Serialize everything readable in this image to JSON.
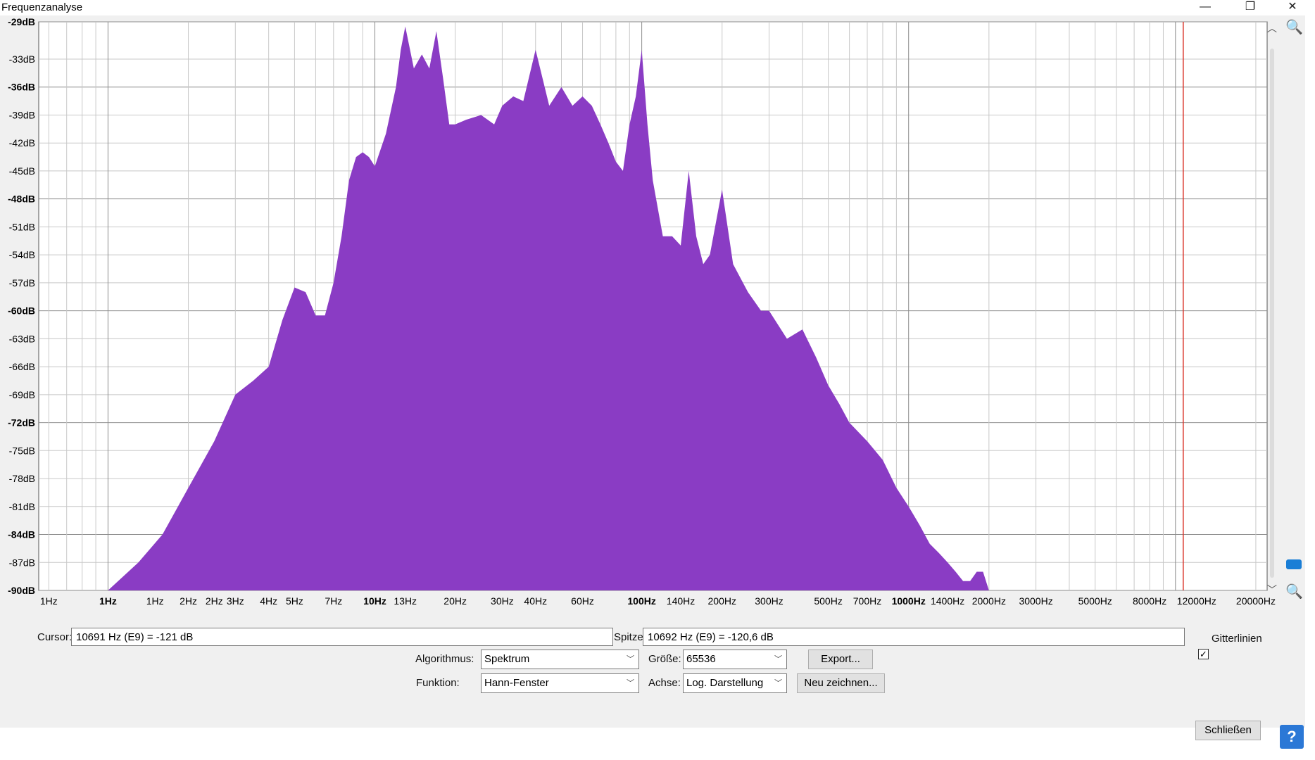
{
  "window": {
    "title": "Frequenzanalyse",
    "minimize": "—",
    "restore": "❐",
    "close": "✕"
  },
  "colors": {
    "spectrum": "#8a3cc4",
    "cursor_line": "#d9342b",
    "grid": "#c8c8c8",
    "grid_major": "#8c8c8c"
  },
  "chart_data": {
    "type": "area",
    "title": "",
    "xlabel": "",
    "ylabel": "",
    "x_scale": "log",
    "xlim": [
      1,
      22050
    ],
    "ylim": [
      -90,
      -29
    ],
    "grid": true,
    "legend": "none",
    "y_ticks": [
      {
        "label": "-29dB",
        "value": -29,
        "bold": true
      },
      {
        "label": "-33dB",
        "value": -33,
        "bold": false
      },
      {
        "label": "-36dB",
        "value": -36,
        "bold": true
      },
      {
        "label": "-39dB",
        "value": -39,
        "bold": false
      },
      {
        "label": "-42dB",
        "value": -42,
        "bold": false
      },
      {
        "label": "-45dB",
        "value": -45,
        "bold": false
      },
      {
        "label": "-48dB",
        "value": -48,
        "bold": true
      },
      {
        "label": "-51dB",
        "value": -51,
        "bold": false
      },
      {
        "label": "-54dB",
        "value": -54,
        "bold": false
      },
      {
        "label": "-57dB",
        "value": -57,
        "bold": false
      },
      {
        "label": "-60dB",
        "value": -60,
        "bold": true
      },
      {
        "label": "-63dB",
        "value": -63,
        "bold": false
      },
      {
        "label": "-66dB",
        "value": -66,
        "bold": false
      },
      {
        "label": "-69dB",
        "value": -69,
        "bold": false
      },
      {
        "label": "-72dB",
        "value": -72,
        "bold": true
      },
      {
        "label": "-75dB",
        "value": -75,
        "bold": false
      },
      {
        "label": "-78dB",
        "value": -78,
        "bold": false
      },
      {
        "label": "-81dB",
        "value": -81,
        "bold": false
      },
      {
        "label": "-84dB",
        "value": -84,
        "bold": true
      },
      {
        "label": "-87dB",
        "value": -87,
        "bold": false
      },
      {
        "label": "-90dB",
        "value": -90,
        "bold": true
      }
    ],
    "x_ticks": [
      {
        "label": "1Hz",
        "value": 0.6,
        "bold": false
      },
      {
        "label": "1Hz",
        "value": 1,
        "bold": true
      },
      {
        "label": "1Hz",
        "value": 1.5,
        "bold": false
      },
      {
        "label": "2Hz",
        "value": 2,
        "bold": false
      },
      {
        "label": "2Hz",
        "value": 2.5,
        "bold": false
      },
      {
        "label": "3Hz",
        "value": 3,
        "bold": false
      },
      {
        "label": "4Hz",
        "value": 4,
        "bold": false
      },
      {
        "label": "5Hz",
        "value": 5,
        "bold": false
      },
      {
        "label": "7Hz",
        "value": 7,
        "bold": false
      },
      {
        "label": "10Hz",
        "value": 10,
        "bold": true
      },
      {
        "label": "13Hz",
        "value": 13,
        "bold": false
      },
      {
        "label": "20Hz",
        "value": 20,
        "bold": false
      },
      {
        "label": "30Hz",
        "value": 30,
        "bold": false
      },
      {
        "label": "40Hz",
        "value": 40,
        "bold": false
      },
      {
        "label": "60Hz",
        "value": 60,
        "bold": false
      },
      {
        "label": "100Hz",
        "value": 100,
        "bold": true
      },
      {
        "label": "140Hz",
        "value": 140,
        "bold": false
      },
      {
        "label": "200Hz",
        "value": 200,
        "bold": false
      },
      {
        "label": "300Hz",
        "value": 300,
        "bold": false
      },
      {
        "label": "500Hz",
        "value": 500,
        "bold": false
      },
      {
        "label": "700Hz",
        "value": 700,
        "bold": false
      },
      {
        "label": "1000Hz",
        "value": 1000,
        "bold": true
      },
      {
        "label": "1400Hz",
        "value": 1400,
        "bold": false
      },
      {
        "label": "2000Hz",
        "value": 2000,
        "bold": false
      },
      {
        "label": "3000Hz",
        "value": 3000,
        "bold": false
      },
      {
        "label": "5000Hz",
        "value": 5000,
        "bold": false
      },
      {
        "label": "8000Hz",
        "value": 8000,
        "bold": false
      },
      {
        "label": "12000Hz",
        "value": 12000,
        "bold": false
      },
      {
        "label": "20000Hz",
        "value": 20000,
        "bold": false
      }
    ],
    "cursor_frequency": 10691,
    "series": [
      {
        "x": [
          1,
          1.3,
          1.6,
          2,
          2.5,
          3,
          3.5,
          4,
          4.5,
          5,
          5.5,
          6,
          6.5,
          7,
          7.5,
          8,
          8.5,
          9,
          9.5,
          10,
          11,
          12,
          12.5,
          13,
          14,
          15,
          16,
          17,
          18,
          19,
          20,
          22,
          25,
          28,
          30,
          33,
          36,
          40,
          45,
          50,
          55,
          60,
          65,
          70,
          75,
          80,
          85,
          90,
          95,
          100,
          105,
          110,
          120,
          130,
          140,
          150,
          160,
          170,
          180,
          200,
          220,
          250,
          280,
          300,
          350,
          400,
          450,
          500,
          550,
          600,
          700,
          800,
          900,
          1000,
          1100,
          1200,
          1300,
          1400,
          1500,
          1600,
          1700,
          1800,
          1900,
          2000,
          2100
        ],
        "y": [
          -90,
          -87,
          -84,
          -79,
          -74,
          -69,
          -67.5,
          -66,
          -61,
          -57.5,
          -58,
          -60.5,
          -60.5,
          -57,
          -52,
          -46,
          -43.5,
          -43,
          -43.5,
          -44.5,
          -41,
          -36,
          -32,
          -29.5,
          -34,
          -32.5,
          -34,
          -30,
          -35,
          -40,
          -40,
          -39.5,
          -39,
          -40,
          -38,
          -37,
          -37.5,
          -32,
          -38,
          -36,
          -38,
          -37,
          -38,
          -40,
          -42,
          -44,
          -45,
          -40,
          -37,
          -32,
          -40,
          -46,
          -52,
          -52,
          -53,
          -45,
          -52,
          -55,
          -54,
          -47,
          -55,
          -58,
          -60,
          -60,
          -63,
          -62,
          -65,
          -68,
          -70,
          -72,
          -74,
          -76,
          -79,
          -81,
          -83,
          -85,
          -86,
          -87,
          -88,
          -89,
          -89,
          -88,
          -88,
          -90,
          -90
        ]
      }
    ]
  },
  "status": {
    "cursor_label": "Cursor:",
    "cursor_value": "10691 Hz (E9) = -121 dB",
    "peak_label": "Spitze:",
    "peak_value": "10692 Hz (E9) = -120,6 dB",
    "grid_label": "Gitterlinien",
    "grid_checked": "✓"
  },
  "controls": {
    "algorithm_label": "Algorithmus:",
    "algorithm_value": "Spektrum",
    "size_label": "Größe:",
    "size_value": "65536",
    "export_button": "Export...",
    "function_label": "Funktion:",
    "function_value": "Hann-Fenster",
    "axis_label": "Achse:",
    "axis_value": "Log. Darstellung",
    "redraw_button": "Neu zeichnen...",
    "close_button": "Schließen",
    "help_button": "?"
  }
}
